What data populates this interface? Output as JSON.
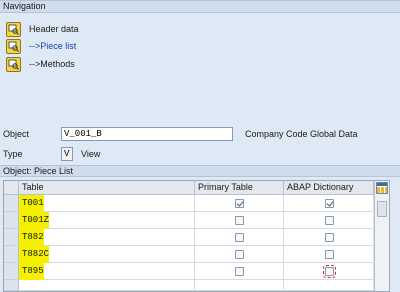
{
  "navigation": {
    "title": "Navigation",
    "items": [
      {
        "label": "Header data",
        "link": false
      },
      {
        "label": "-->Piece list",
        "link": true
      },
      {
        "label": "-->Methods",
        "link": false
      }
    ]
  },
  "object": {
    "label": "Object",
    "value": "V_001_B",
    "description": "Company Code Global Data"
  },
  "type": {
    "label": "Type",
    "value": "V",
    "description": "View"
  },
  "piece_list": {
    "title": "Object: Piece List",
    "columns": [
      "Table",
      "Primary Table",
      "ABAP Dictionary"
    ],
    "rows": [
      {
        "table": "T001",
        "primary": true,
        "abap": true
      },
      {
        "table": "T001Z",
        "primary": false,
        "abap": false
      },
      {
        "table": "T882",
        "primary": false,
        "abap": false
      },
      {
        "table": "T882C",
        "primary": false,
        "abap": false
      },
      {
        "table": "T895",
        "primary": false,
        "abap": false
      }
    ]
  },
  "colors": {
    "highlight": "#f4f000",
    "nav_header": "#cfdcec",
    "background": "#dfe9f5",
    "link": "#1c3fb0"
  },
  "icons": {
    "nav_item": "navigation-object-icon",
    "layout": "table-layout-icon"
  }
}
